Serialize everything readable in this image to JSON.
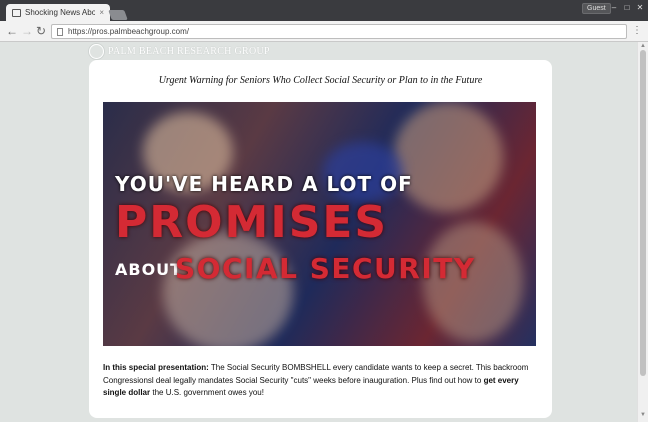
{
  "browser": {
    "tab_title": "Shocking News About",
    "tab_close": "×",
    "guest_label": "Guest",
    "url": "https://pros.palmbeachgroup.com/",
    "window_controls": [
      "–",
      "□",
      "✕"
    ]
  },
  "page": {
    "logo_text": "PALM BEACH RESEARCH GROUP",
    "headline": "Urgent Warning for Seniors Who Collect Social Security or Plan to in the Future",
    "hero": {
      "line1": "YOU'VE HEARD A LOT OF",
      "line2": "PROMISES",
      "line3a": "ABOUT",
      "line3b": "SOCIAL SECURITY"
    },
    "body": {
      "lead_bold": "In this special presentation:",
      "text1": " The Social Security BOMBSHELL every candidate wants to keep a secret. This backroom Congressionsl deal legally mandates Social Security \"cuts\" weeks before inauguration. Plus find out how to ",
      "bold2": "get every single dollar",
      "text2": " the U.S. government owes you!"
    }
  },
  "colors": {
    "page_bg": "#dfe3e1",
    "hero_red": "#d42a34",
    "chrome_dark": "#3a3b3f"
  }
}
